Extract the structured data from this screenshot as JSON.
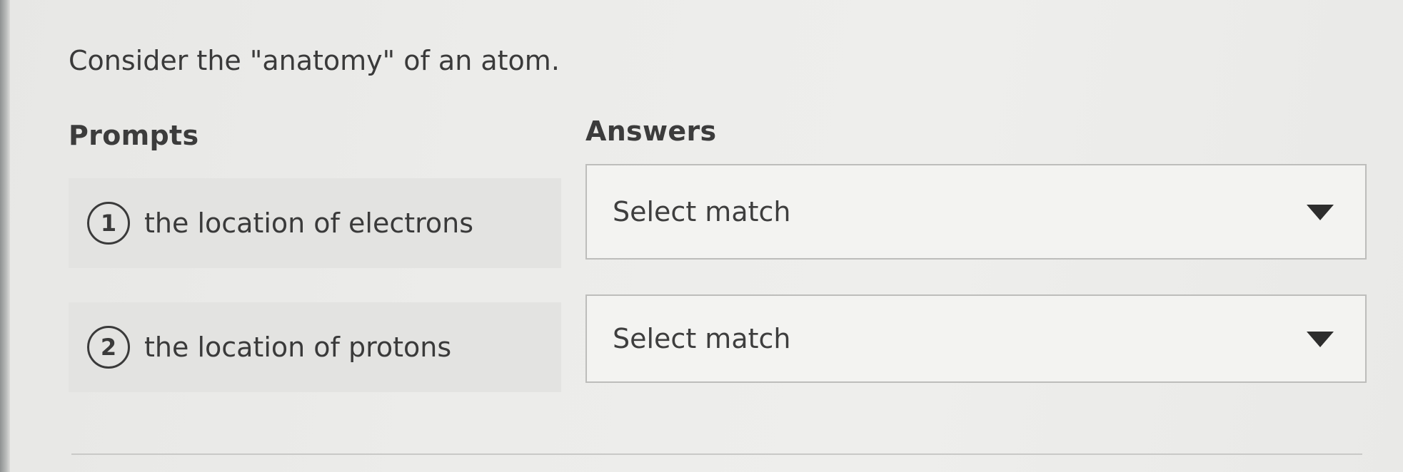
{
  "question": "Consider the \"anatomy\" of an atom.",
  "headings": {
    "prompts": "Prompts",
    "answers": "Answers"
  },
  "prompts": [
    {
      "number": "1",
      "text": "the location of electrons"
    },
    {
      "number": "2",
      "text": "the location of protons"
    }
  ],
  "answers": [
    {
      "selected": "Select match",
      "icon": "chevron-down-icon"
    },
    {
      "selected": "Select match",
      "icon": "chevron-down-icon"
    }
  ]
}
